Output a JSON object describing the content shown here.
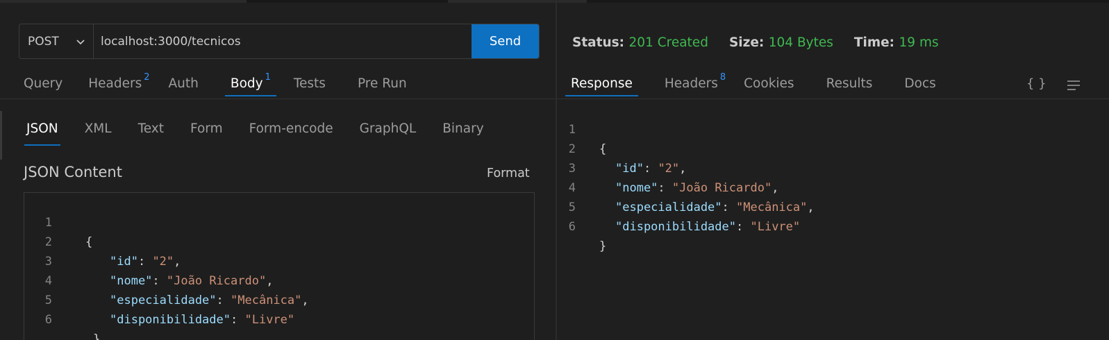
{
  "request": {
    "method": "POST",
    "url": "localhost:3000/tecnicos",
    "send_label": "Send"
  },
  "request_tabs": [
    {
      "label": "Query",
      "badge": ""
    },
    {
      "label": "Headers",
      "badge": "2"
    },
    {
      "label": "Auth",
      "badge": ""
    },
    {
      "label": "Body",
      "badge": "1",
      "active": true
    },
    {
      "label": "Tests",
      "badge": ""
    },
    {
      "label": "Pre Run",
      "badge": ""
    }
  ],
  "body_tabs": [
    {
      "label": "JSON",
      "active": true
    },
    {
      "label": "XML"
    },
    {
      "label": "Text"
    },
    {
      "label": "Form"
    },
    {
      "label": "Form-encode"
    },
    {
      "label": "GraphQL"
    },
    {
      "label": "Binary"
    }
  ],
  "body": {
    "content_label": "JSON Content",
    "format_label": "Format",
    "lines": [
      {
        "n": "1",
        "open": "{"
      },
      {
        "n": "2",
        "key": "\"id\"",
        "value": "\"2\"",
        "trail": ","
      },
      {
        "n": "3",
        "key": "\"nome\"",
        "value": "\"João Ricardo\"",
        "trail": ","
      },
      {
        "n": "4",
        "key": "\"especialidade\"",
        "value": "\"Mecânica\"",
        "trail": ","
      },
      {
        "n": "5",
        "key": "\"disponibilidade\"",
        "value": "\"Livre\"",
        "trail": ""
      },
      {
        "n": "6",
        "close": "}"
      }
    ]
  },
  "response": {
    "status_label": "Status:",
    "status_value": "201 Created",
    "size_label": "Size:",
    "size_value": "104 Bytes",
    "time_label": "Time:",
    "time_value": "19 ms",
    "tabs": [
      {
        "label": "Response",
        "badge": "",
        "active": true
      },
      {
        "label": "Headers",
        "badge": "8"
      },
      {
        "label": "Cookies",
        "badge": ""
      },
      {
        "label": "Results",
        "badge": ""
      },
      {
        "label": "Docs",
        "badge": ""
      }
    ],
    "lines": [
      {
        "n": "1",
        "open": "{"
      },
      {
        "n": "2",
        "key": "\"id\"",
        "value": "\"2\"",
        "trail": ","
      },
      {
        "n": "3",
        "key": "\"nome\"",
        "value": "\"João Ricardo\"",
        "trail": ","
      },
      {
        "n": "4",
        "key": "\"especialidade\"",
        "value": "\"Mecânica\"",
        "trail": ","
      },
      {
        "n": "5",
        "key": "\"disponibilidade\"",
        "value": "\"Livre\"",
        "trail": ""
      },
      {
        "n": "6",
        "close": "}"
      }
    ],
    "braces_icon": "{ }"
  },
  "colors": {
    "accent": "#0e70c0",
    "badge": "#3794ff",
    "success": "#3fb950",
    "json_key": "#9cdcfe",
    "json_string": "#ce9178"
  },
  "icons": [
    "chevron-down-icon",
    "json-braces-icon",
    "menu-lines-icon"
  ]
}
